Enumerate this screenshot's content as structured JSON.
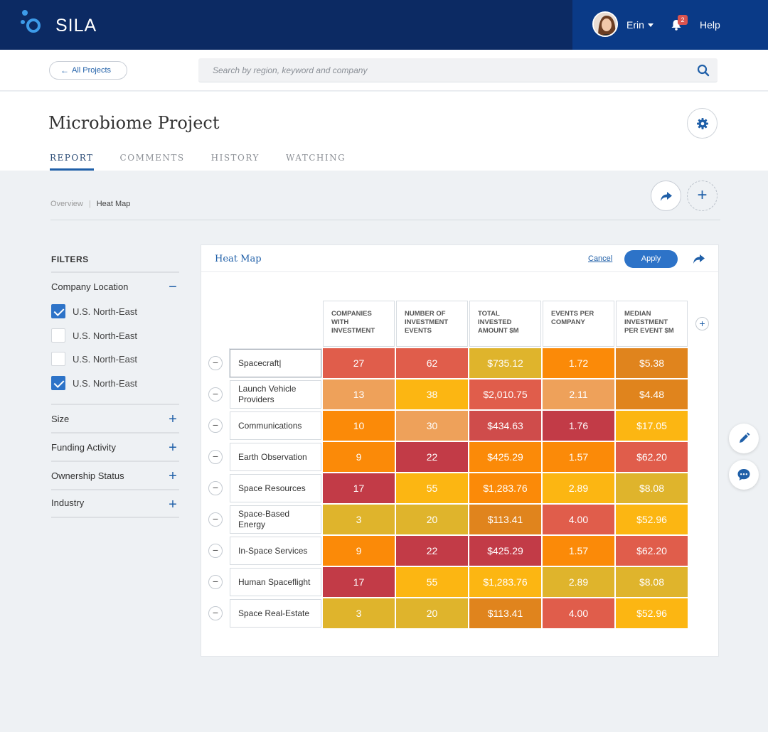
{
  "app": {
    "brand": "SILA"
  },
  "user": {
    "name": "Erin",
    "notifications": "2"
  },
  "header": {
    "help": "Help"
  },
  "nav": {
    "back_label": "All Projects"
  },
  "search": {
    "placeholder": "Search by region, keyword and company"
  },
  "project": {
    "title": "Microbiome Project"
  },
  "tabs": [
    {
      "label": "REPORT",
      "active": true
    },
    {
      "label": "COMMENTS",
      "active": false
    },
    {
      "label": "HISTORY",
      "active": false
    },
    {
      "label": "WATCHING",
      "active": false
    }
  ],
  "breadcrumb": {
    "parent": "Overview",
    "current": "Heat Map"
  },
  "filters": {
    "title": "FILTERS",
    "company_location": {
      "label": "Company Location",
      "options": [
        {
          "label": "U.S. North-East",
          "checked": true
        },
        {
          "label": "U.S. North-East",
          "checked": false
        },
        {
          "label": "U.S. North-East",
          "checked": false
        },
        {
          "label": "U.S. North-East",
          "checked": true
        }
      ]
    },
    "groups": [
      "Size",
      "Funding Activity",
      "Ownership Status",
      "Industry"
    ]
  },
  "panel": {
    "title": "Heat Map",
    "cancel": "Cancel",
    "apply": "Apply"
  },
  "heatmap": {
    "columns": [
      "COMPANIES WITH INVESTMENT",
      "NUMBER OF INVESTMENT EVENTS",
      "TOTAL INVESTED AMOUNT $M",
      "EVENTS PER COMPANY",
      "MEDIAN INVESTMENT PER EVENT $M"
    ],
    "rows": [
      {
        "label": "Spacecraft|",
        "cells": [
          {
            "v": "27",
            "c": "#e05d4b"
          },
          {
            "v": "62",
            "c": "#e05d4b"
          },
          {
            "v": "$735.12",
            "c": "#dfb42c"
          },
          {
            "v": "1.72",
            "c": "#fb8a08"
          },
          {
            "v": "$5.38",
            "c": "#e0841d"
          }
        ]
      },
      {
        "label": "Launch Vehicle Providers",
        "cells": [
          {
            "v": "13",
            "c": "#eea15a"
          },
          {
            "v": "38",
            "c": "#fcb612"
          },
          {
            "v": "$2,010.75",
            "c": "#e05d4b"
          },
          {
            "v": "2.11",
            "c": "#eea15a"
          },
          {
            "v": "$4.48",
            "c": "#e0841d"
          }
        ]
      },
      {
        "label": "Communications",
        "cells": [
          {
            "v": "10",
            "c": "#fb8a08"
          },
          {
            "v": "30",
            "c": "#eea15a"
          },
          {
            "v": "$434.63",
            "c": "#cf4c4b"
          },
          {
            "v": "1.76",
            "c": "#c23b47"
          },
          {
            "v": "$17.05",
            "c": "#fcb612"
          }
        ]
      },
      {
        "label": "Earth Observation",
        "cells": [
          {
            "v": "9",
            "c": "#fb8a08"
          },
          {
            "v": "22",
            "c": "#c23b47"
          },
          {
            "v": "$425.29",
            "c": "#fb8a08"
          },
          {
            "v": "1.57",
            "c": "#fb8a08"
          },
          {
            "v": "$62.20",
            "c": "#e05d4b"
          }
        ]
      },
      {
        "label": "Space Resources",
        "cells": [
          {
            "v": "17",
            "c": "#c23b47"
          },
          {
            "v": "55",
            "c": "#fcb612"
          },
          {
            "v": "$1,283.76",
            "c": "#fb8a08"
          },
          {
            "v": "2.89",
            "c": "#fcb612"
          },
          {
            "v": "$8.08",
            "c": "#dfb42c"
          }
        ]
      },
      {
        "label": "Space-Based Energy",
        "cells": [
          {
            "v": "3",
            "c": "#dfb42c"
          },
          {
            "v": "20",
            "c": "#dfb42c"
          },
          {
            "v": "$113.41",
            "c": "#e0841d"
          },
          {
            "v": "4.00",
            "c": "#e05d4b"
          },
          {
            "v": "$52.96",
            "c": "#fcb612"
          }
        ]
      },
      {
        "label": "In-Space Services",
        "cells": [
          {
            "v": "9",
            "c": "#fb8a08"
          },
          {
            "v": "22",
            "c": "#c23b47"
          },
          {
            "v": "$425.29",
            "c": "#c23b47"
          },
          {
            "v": "1.57",
            "c": "#fb8a08"
          },
          {
            "v": "$62.20",
            "c": "#e05d4b"
          }
        ]
      },
      {
        "label": "Human Spaceflight",
        "cells": [
          {
            "v": "17",
            "c": "#c23b47"
          },
          {
            "v": "55",
            "c": "#fcb612"
          },
          {
            "v": "$1,283.76",
            "c": "#fcb612"
          },
          {
            "v": "2.89",
            "c": "#dfb42c"
          },
          {
            "v": "$8.08",
            "c": "#dfb42c"
          }
        ]
      },
      {
        "label": "Space Real-Estate",
        "cells": [
          {
            "v": "3",
            "c": "#dfb42c"
          },
          {
            "v": "20",
            "c": "#dfb42c"
          },
          {
            "v": "$113.41",
            "c": "#e0841d"
          },
          {
            "v": "4.00",
            "c": "#e05d4b"
          },
          {
            "v": "$52.96",
            "c": "#fcb612"
          }
        ]
      }
    ]
  },
  "colors": {
    "navy": "#0c2a63",
    "accent": "#1f5fa8",
    "apply": "#2d73c8"
  }
}
